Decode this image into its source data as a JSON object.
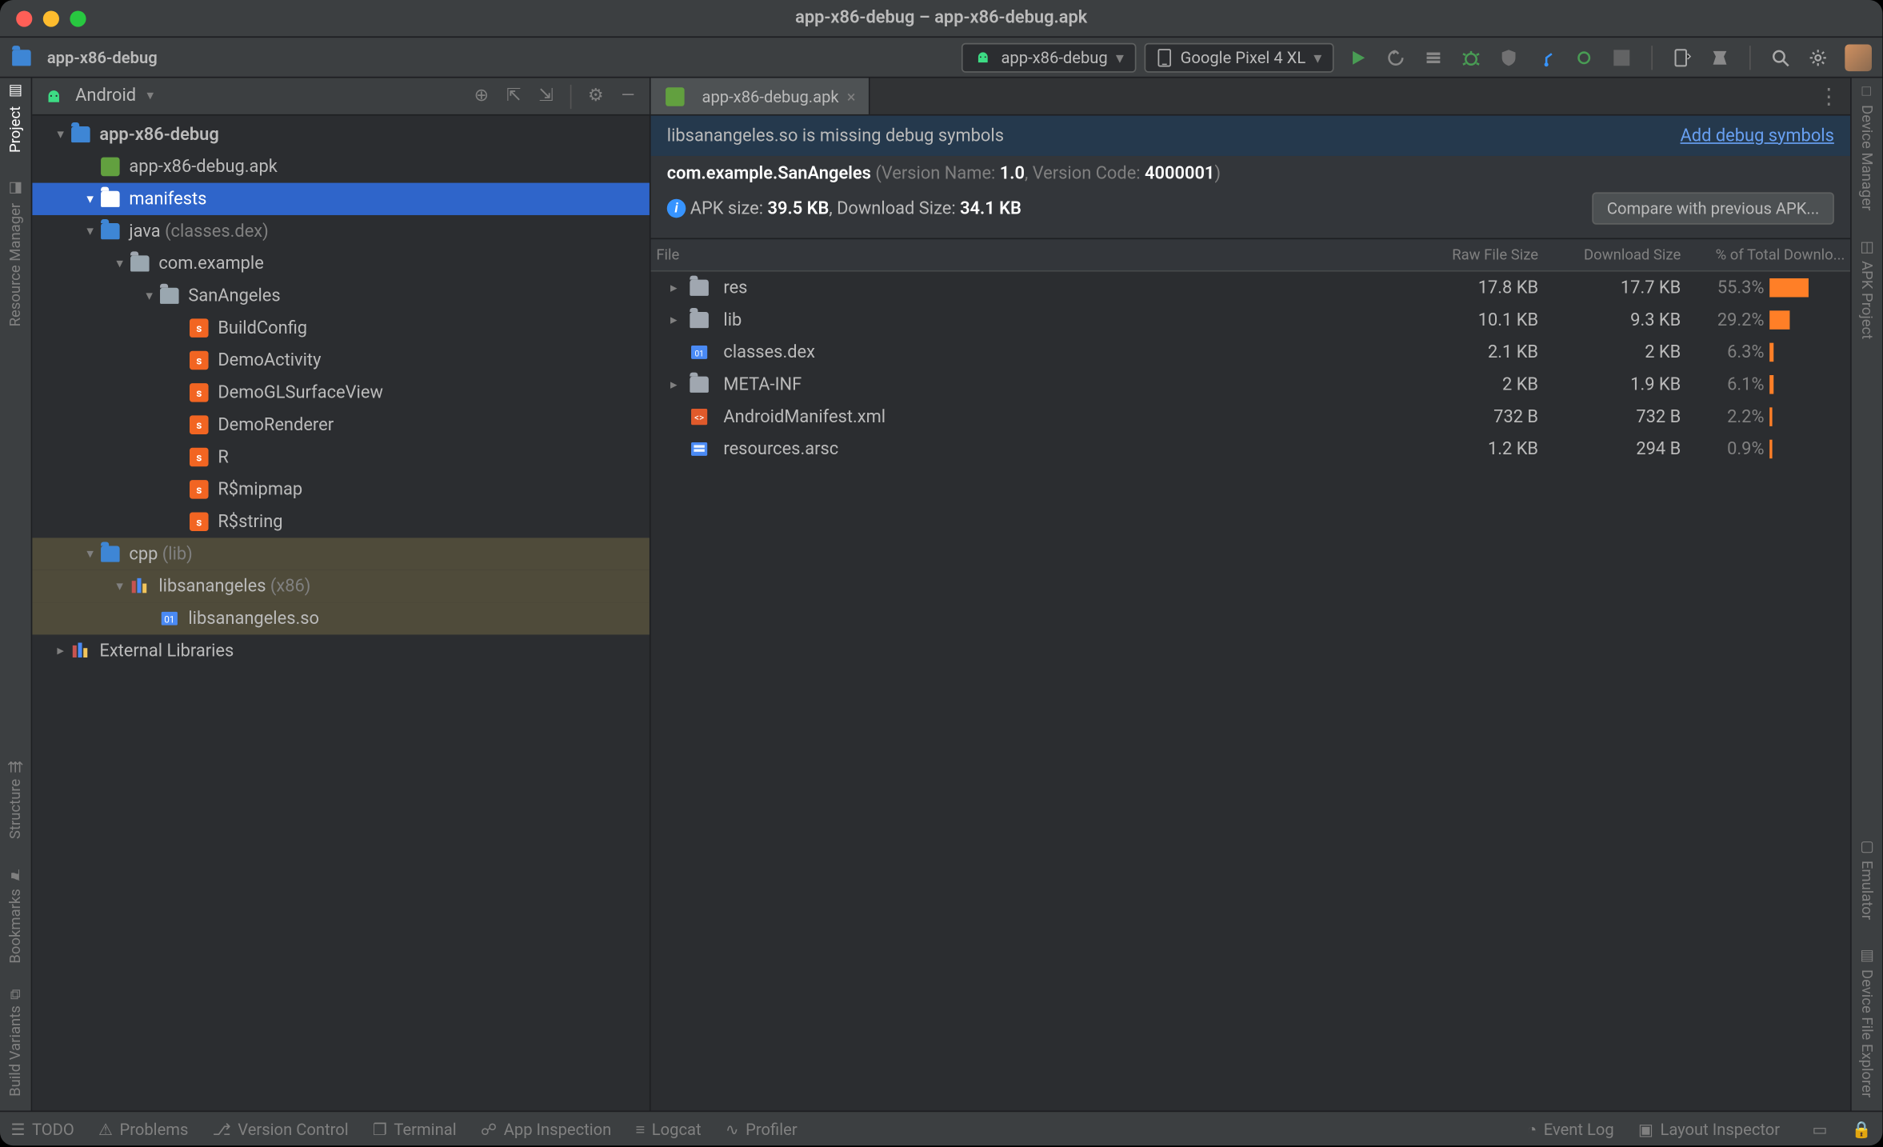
{
  "window": {
    "title": "app-x86-debug – app-x86-debug.apk"
  },
  "breadcrumb": {
    "project": "app-x86-debug"
  },
  "toolbar": {
    "run_config": "app-x86-debug",
    "device": "Google Pixel 4 XL"
  },
  "left_strips": [
    {
      "label": "Project",
      "active": true
    },
    {
      "label": "Resource Manager",
      "active": false
    },
    {
      "label": "Structure",
      "active": false
    },
    {
      "label": "Bookmarks",
      "active": false
    },
    {
      "label": "Build Variants",
      "active": false
    }
  ],
  "right_strips": [
    {
      "label": "Device Manager"
    },
    {
      "label": "APK Project"
    },
    {
      "label": "Emulator"
    },
    {
      "label": "Device File Explorer"
    }
  ],
  "panel": {
    "selector": "Android"
  },
  "tree": [
    {
      "depth": 0,
      "chev": "down",
      "icon": "module",
      "label": "app-x86-debug",
      "bold": true
    },
    {
      "depth": 1,
      "chev": "",
      "icon": "apk",
      "label": "app-x86-debug.apk"
    },
    {
      "depth": 1,
      "chev": "down",
      "icon": "folder-blue",
      "label": "manifests",
      "selected": true
    },
    {
      "depth": 1,
      "chev": "down",
      "icon": "folder-blue",
      "label": "java",
      "suffix": "(classes.dex)"
    },
    {
      "depth": 2,
      "chev": "down",
      "icon": "package",
      "label": "com.example"
    },
    {
      "depth": 3,
      "chev": "down",
      "icon": "package",
      "label": "SanAngeles"
    },
    {
      "depth": 4,
      "chev": "",
      "icon": "scala",
      "label": "BuildConfig"
    },
    {
      "depth": 4,
      "chev": "",
      "icon": "scala",
      "label": "DemoActivity"
    },
    {
      "depth": 4,
      "chev": "",
      "icon": "scala",
      "label": "DemoGLSurfaceView"
    },
    {
      "depth": 4,
      "chev": "",
      "icon": "scala",
      "label": "DemoRenderer"
    },
    {
      "depth": 4,
      "chev": "",
      "icon": "scala",
      "label": "R"
    },
    {
      "depth": 4,
      "chev": "",
      "icon": "scala",
      "label": "R$mipmap"
    },
    {
      "depth": 4,
      "chev": "",
      "icon": "scala",
      "label": "R$string"
    },
    {
      "depth": 1,
      "chev": "down",
      "icon": "folder-blue",
      "label": "cpp",
      "suffix": "(lib)",
      "highlighted": true
    },
    {
      "depth": 2,
      "chev": "down",
      "icon": "lib",
      "label": "libsanangeles",
      "suffix": "(x86)",
      "highlighted": true
    },
    {
      "depth": 3,
      "chev": "",
      "icon": "so",
      "label": "libsanangeles.so",
      "highlighted": true
    },
    {
      "depth": 0,
      "chev": "right",
      "icon": "libs",
      "label": "External Libraries"
    }
  ],
  "editor": {
    "tab": {
      "label": "app-x86-debug.apk"
    },
    "banner": {
      "text": "libsanangeles.so is missing debug symbols",
      "action": "Add debug symbols"
    },
    "meta": {
      "package": "com.example.SanAngeles",
      "version_name_label": "Version Name:",
      "version_name": "1.0",
      "version_code_label": "Version Code:",
      "version_code": "4000001",
      "size_prefix": "APK size:",
      "apk_size": "39.5 KB",
      "dl_prefix": "Download Size:",
      "dl_size": "34.1 KB",
      "compare_btn": "Compare with previous APK..."
    },
    "table": {
      "headers": {
        "file": "File",
        "raw": "Raw File Size",
        "dl": "Download Size",
        "pct": "% of Total Downlo..."
      },
      "rows": [
        {
          "chev": "right",
          "icon": "folder",
          "name": "res",
          "raw": "17.8 KB",
          "dl": "17.7 KB",
          "pct": "55.3%",
          "bar": 55.3
        },
        {
          "chev": "right",
          "icon": "folder",
          "name": "lib",
          "raw": "10.1 KB",
          "dl": "9.3 KB",
          "pct": "29.2%",
          "bar": 29.2
        },
        {
          "chev": "",
          "icon": "dex",
          "name": "classes.dex",
          "raw": "2.1 KB",
          "dl": "2 KB",
          "pct": "6.3%",
          "bar": 6.3
        },
        {
          "chev": "right",
          "icon": "folder",
          "name": "META-INF",
          "raw": "2 KB",
          "dl": "1.9 KB",
          "pct": "6.1%",
          "bar": 6.1
        },
        {
          "chev": "",
          "icon": "xml",
          "name": "AndroidManifest.xml",
          "raw": "732 B",
          "dl": "732 B",
          "pct": "2.2%",
          "bar": 2.2
        },
        {
          "chev": "",
          "icon": "arsc",
          "name": "resources.arsc",
          "raw": "1.2 KB",
          "dl": "294 B",
          "pct": "0.9%",
          "bar": 0.9
        }
      ]
    }
  },
  "bottom_bar": {
    "left": [
      "TODO",
      "Problems",
      "Version Control",
      "Terminal",
      "App Inspection",
      "Logcat",
      "Profiler"
    ],
    "right": [
      "Event Log",
      "Layout Inspector"
    ]
  }
}
